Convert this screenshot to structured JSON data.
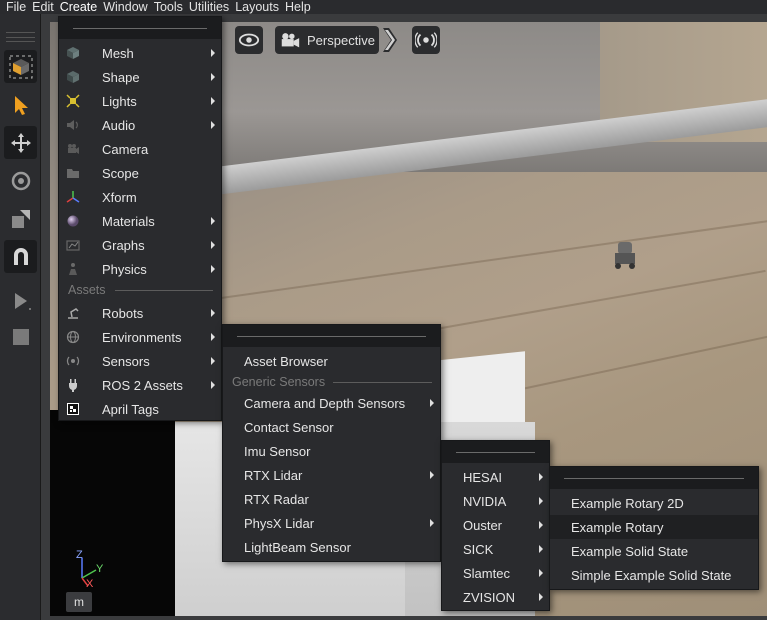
{
  "menubar": {
    "items": [
      "File",
      "Edit",
      "Create",
      "Window",
      "Tools",
      "Utilities",
      "Layouts",
      "Help"
    ]
  },
  "viewport": {
    "camera_label": "Perspective",
    "axes": {
      "z": "Z",
      "y": "Y",
      "x": "X"
    },
    "m_button": "m"
  },
  "create_menu": {
    "items": [
      {
        "label": "Mesh",
        "icon": "cube-icon",
        "submenu": true
      },
      {
        "label": "Shape",
        "icon": "shape-icon",
        "submenu": true
      },
      {
        "label": "Lights",
        "icon": "light-icon",
        "submenu": true
      },
      {
        "label": "Audio",
        "icon": "speaker-icon",
        "submenu": true
      },
      {
        "label": "Camera",
        "icon": "camera-icon",
        "submenu": false
      },
      {
        "label": "Scope",
        "icon": "folder-icon",
        "submenu": false
      },
      {
        "label": "Xform",
        "icon": "xform-axes-icon",
        "submenu": false
      },
      {
        "label": "Materials",
        "icon": "sphere-icon",
        "submenu": true
      },
      {
        "label": "Graphs",
        "icon": "graph-icon",
        "submenu": true
      },
      {
        "label": "Physics",
        "icon": "physics-icon",
        "submenu": true
      }
    ],
    "assets_section": "Assets",
    "asset_items": [
      {
        "label": "Robots",
        "icon": "robot-arm-icon",
        "submenu": true
      },
      {
        "label": "Environments",
        "icon": "globe-icon",
        "submenu": true
      },
      {
        "label": "Sensors",
        "icon": "sensor-icon",
        "submenu": true
      },
      {
        "label": "ROS 2 Assets",
        "icon": "plug-icon",
        "submenu": true
      },
      {
        "label": "April Tags",
        "icon": "apriltag-icon",
        "submenu": false
      }
    ]
  },
  "sensors_menu": {
    "first_item": "Asset Browser",
    "section": "Generic Sensors",
    "items": [
      {
        "label": "Camera and Depth Sensors",
        "submenu": true
      },
      {
        "label": "Contact Sensor",
        "submenu": false
      },
      {
        "label": "Imu Sensor",
        "submenu": false
      },
      {
        "label": "RTX Lidar",
        "submenu": true
      },
      {
        "label": "RTX Radar",
        "submenu": false
      },
      {
        "label": "PhysX Lidar",
        "submenu": true
      },
      {
        "label": "LightBeam Sensor",
        "submenu": false
      }
    ]
  },
  "lidar_menu": {
    "items": [
      "HESAI",
      "NVIDIA",
      "Ouster",
      "SICK",
      "Slamtec",
      "ZVISION"
    ]
  },
  "ouster_menu": {
    "items": [
      "Example Rotary 2D",
      "Example Rotary",
      "Example Solid State",
      "Simple Example Solid State"
    ],
    "highlighted": "Example Rotary"
  }
}
